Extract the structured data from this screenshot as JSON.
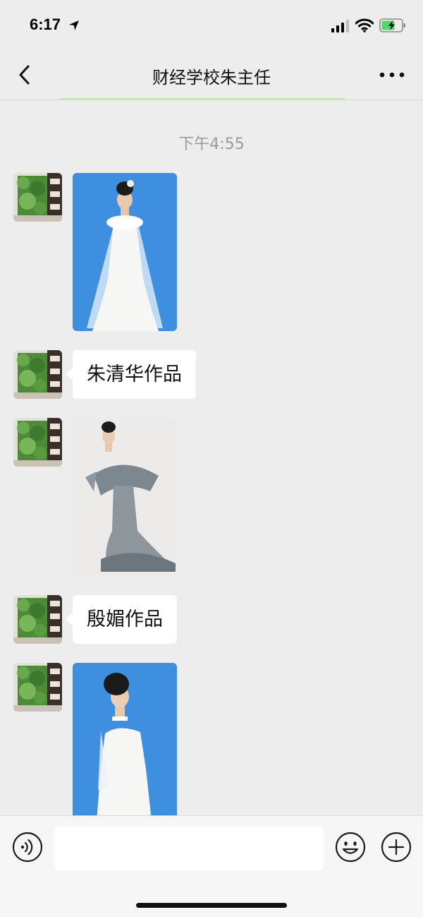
{
  "status": {
    "time": "6:17"
  },
  "nav": {
    "title": "财经学校朱主任"
  },
  "chat": {
    "timestamp": "下午4:55",
    "messages": [
      {
        "type": "image",
        "sender": "朱主任",
        "photo": "bride-white-veil-blue-backdrop"
      },
      {
        "type": "text",
        "sender": "朱主任",
        "text": "朱清华作品"
      },
      {
        "type": "image",
        "sender": "朱主任",
        "photo": "gray-feather-gown"
      },
      {
        "type": "text",
        "sender": "朱主任",
        "text": "殷媚作品"
      },
      {
        "type": "image",
        "sender": "朱主任",
        "photo": "white-dress-blue-backdrop"
      }
    ]
  },
  "input": {
    "value": "",
    "placeholder": ""
  },
  "icons": {
    "back": "chevron-left-icon",
    "more": "more-dots-icon",
    "voice": "voice-icon",
    "emoji": "emoji-icon",
    "plus": "plus-icon"
  },
  "colors": {
    "background": "#ededed",
    "bubble": "#ffffff",
    "timestamp": "#9b9b9b",
    "battery_charge": "#4cd964"
  }
}
